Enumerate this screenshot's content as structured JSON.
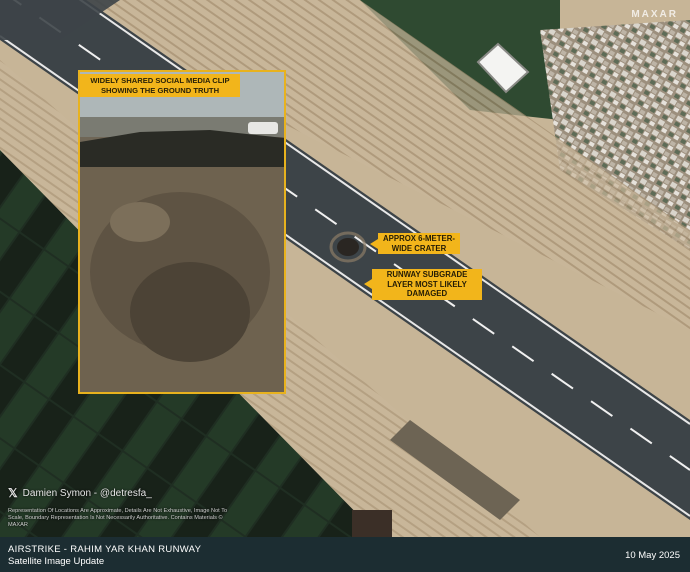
{
  "watermark": "MAXAR",
  "inset": {
    "label": "WIDELY SHARED SOCIAL MEDIA CLIP SHOWING THE GROUND TRUTH"
  },
  "callouts": {
    "crater": "APPROX 6-METER-WIDE CRATER",
    "subgrade": "RUNWAY SUBGRADE LAYER MOST LIKELY DAMAGED"
  },
  "credit": {
    "icon": "x-logo-icon",
    "text": "Damien Symon - @detresfa_"
  },
  "disclaimer": "Representation Of Locations Are Approximate, Details Are Not Exhaustive, Image Not To Scale, Boundary Representation Is Not Necessarily Authoritative. Contains Materials © MAXAR",
  "footer": {
    "title": "AIRSTRIKE  - RAHIM YAR KHAN RUNWAY",
    "subtitle": "Satellite Image Update",
    "date": "10 May 2025"
  },
  "colors": {
    "accent": "#f2b51b",
    "footer_bg": "#1c2d32"
  }
}
